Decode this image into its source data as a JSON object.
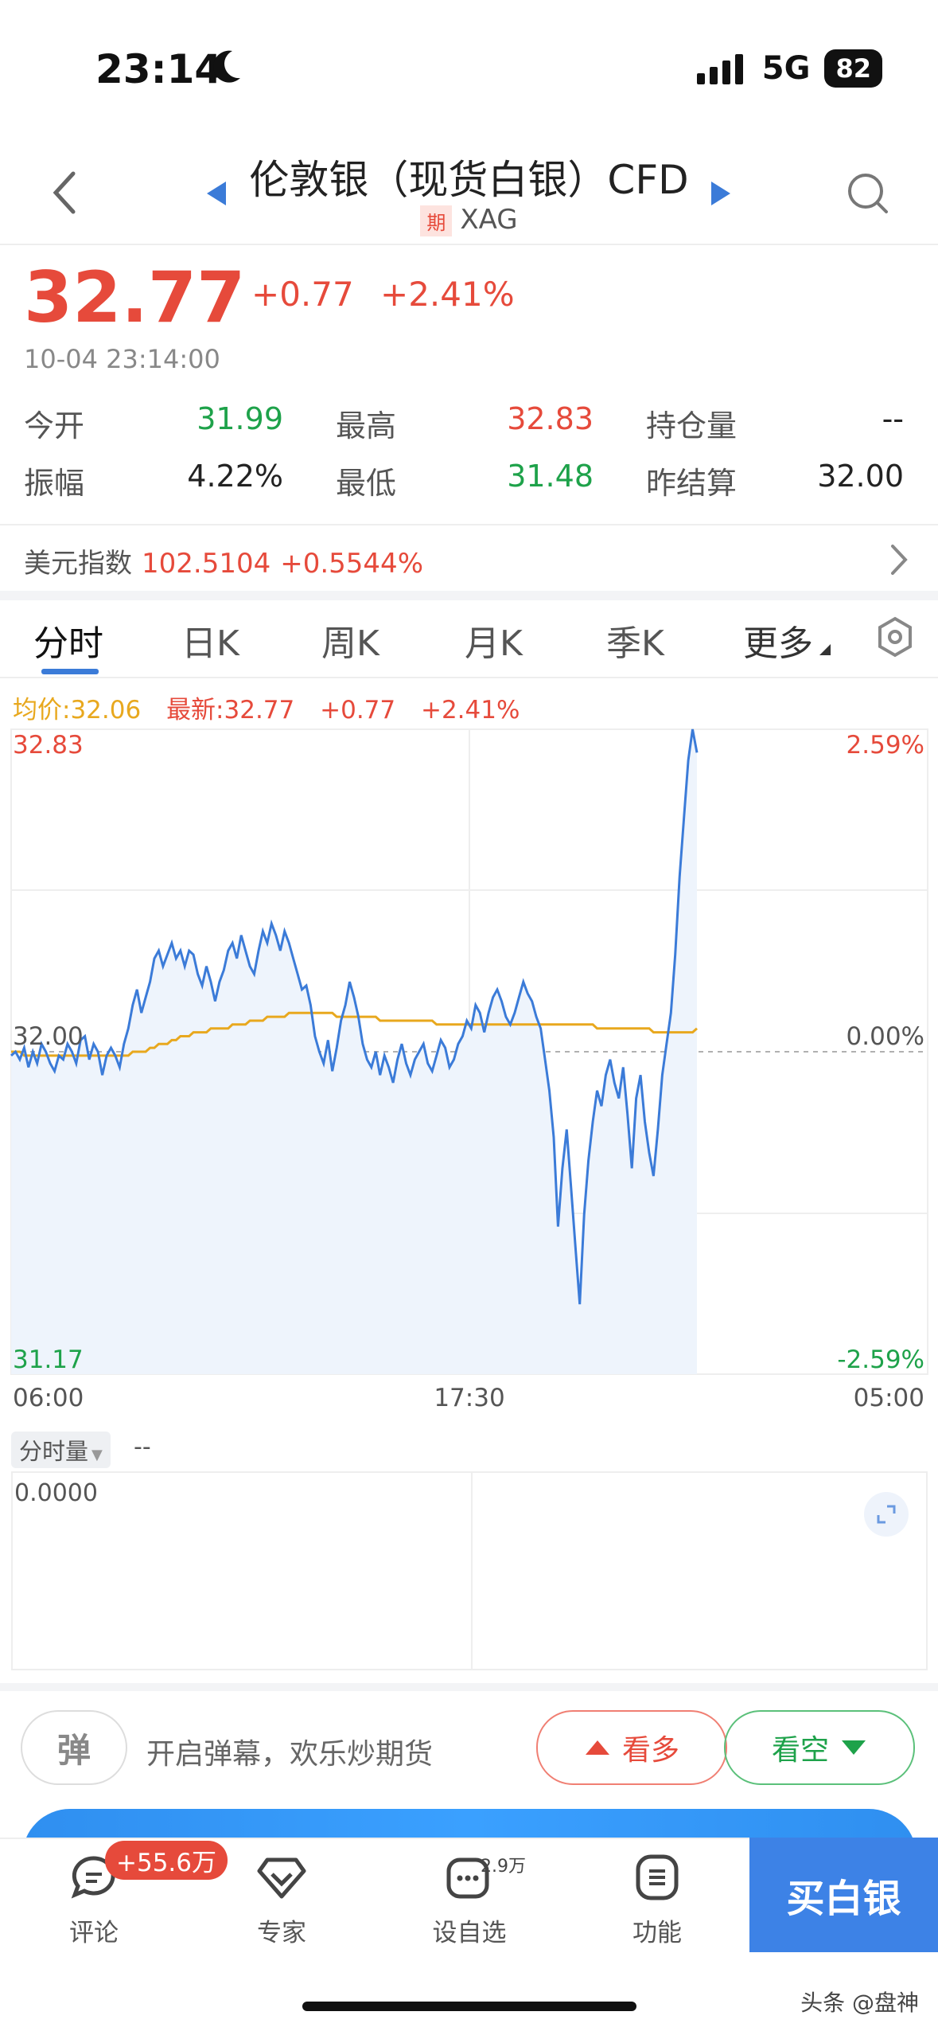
{
  "status_bar": {
    "time": "23:14",
    "network": "5G",
    "battery": "82"
  },
  "header": {
    "title": "伦敦银（现货白银）CFD",
    "tag": "期",
    "symbol": "XAG"
  },
  "quote": {
    "price": "32.77",
    "change": "+0.77",
    "change_pct": "+2.41%",
    "timestamp": "10-04 23:14:00",
    "open_label": "今开",
    "open": "31.99",
    "high_label": "最高",
    "high": "32.83",
    "oi_label": "持仓量",
    "oi": "--",
    "amp_label": "振幅",
    "amp": "4.22%",
    "low_label": "最低",
    "low": "31.48",
    "prev_label": "昨结算",
    "prev": "32.00"
  },
  "index": {
    "label": "美元指数",
    "value": "102.5104",
    "change": "+0.5544%"
  },
  "tabs": [
    "分时",
    "日K",
    "周K",
    "月K",
    "季K",
    "更多"
  ],
  "avg_row": {
    "avg": "均价:32.06",
    "latest": "最新:32.77",
    "chg": "+0.77",
    "pct": "+2.41%"
  },
  "chart_data": {
    "type": "line",
    "y_left": {
      "top": "32.83",
      "mid": "32.00",
      "bottom": "31.17"
    },
    "y_right": {
      "top": "2.59%",
      "mid": "0.00%",
      "bottom": "-2.59%"
    },
    "x_labels": [
      "06:00",
      "17:30",
      "05:00"
    ],
    "ylim": [
      31.17,
      32.83
    ],
    "series": [
      {
        "values": [
          31.99,
          32.0,
          31.98,
          32.01,
          31.96,
          32.0,
          31.97,
          32.02,
          32.0,
          31.97,
          31.95,
          31.99,
          31.98,
          32.02,
          32.0,
          31.97,
          32.03,
          32.04,
          31.98,
          32.02,
          32.0,
          31.94,
          31.99,
          32.01,
          31.99,
          31.96,
          32.02,
          32.06,
          32.12,
          32.16,
          32.1,
          32.14,
          32.18,
          32.24,
          32.26,
          32.22,
          32.25,
          32.28,
          32.24,
          32.26,
          32.22,
          32.26,
          32.25,
          32.2,
          32.17,
          32.22,
          32.18,
          32.13,
          32.18,
          32.21,
          32.26,
          32.28,
          32.24,
          32.3,
          32.26,
          32.22,
          32.2,
          32.26,
          32.31,
          32.28,
          32.33,
          32.3,
          32.26,
          32.31,
          32.28,
          32.24,
          32.2,
          32.16,
          32.17,
          32.12,
          32.04,
          32.0,
          31.97,
          32.03,
          31.95,
          32.01,
          32.08,
          32.12,
          32.18,
          32.14,
          32.09,
          32.02,
          31.98,
          31.96,
          32.0,
          31.94,
          31.99,
          31.96,
          31.92,
          31.98,
          32.02,
          31.97,
          31.94,
          31.98,
          32.0,
          32.02,
          31.97,
          31.95,
          31.99,
          32.03,
          32.01,
          31.96,
          31.98,
          32.02,
          32.04,
          32.08,
          32.06,
          32.12,
          32.1,
          32.05,
          32.1,
          32.14,
          32.16,
          32.13,
          32.09,
          32.07,
          32.1,
          32.14,
          32.18,
          32.15,
          32.13,
          32.09,
          32.06,
          31.98,
          31.9,
          31.78,
          31.55,
          31.7,
          31.8,
          31.65,
          31.5,
          31.35,
          31.58,
          31.72,
          31.82,
          31.9,
          31.86,
          31.94,
          31.98,
          31.92,
          31.88,
          31.96,
          31.84,
          31.7,
          31.88,
          31.94,
          31.82,
          31.74,
          31.68,
          31.8,
          31.94,
          32.02,
          32.1,
          32.25,
          32.45,
          32.6,
          32.75,
          32.83,
          32.77
        ]
      },
      {
        "values": [
          32.0,
          32.0,
          32.0,
          31.99,
          31.99,
          31.99,
          31.99,
          31.99,
          31.99,
          31.99,
          31.99,
          31.99,
          31.99,
          31.99,
          31.99,
          31.99,
          31.99,
          31.99,
          31.99,
          31.99,
          31.99,
          31.99,
          31.99,
          31.99,
          31.99,
          31.99,
          31.99,
          31.99,
          32.0,
          32.0,
          32.0,
          32.0,
          32.01,
          32.01,
          32.02,
          32.02,
          32.02,
          32.03,
          32.03,
          32.04,
          32.04,
          32.04,
          32.05,
          32.05,
          32.05,
          32.05,
          32.06,
          32.06,
          32.06,
          32.06,
          32.06,
          32.07,
          32.07,
          32.07,
          32.07,
          32.08,
          32.08,
          32.08,
          32.08,
          32.09,
          32.09,
          32.09,
          32.09,
          32.09,
          32.1,
          32.1,
          32.1,
          32.1,
          32.1,
          32.1,
          32.1,
          32.1,
          32.1,
          32.1,
          32.1,
          32.09,
          32.09,
          32.09,
          32.09,
          32.09,
          32.09,
          32.09,
          32.09,
          32.09,
          32.09,
          32.08,
          32.08,
          32.08,
          32.08,
          32.08,
          32.08,
          32.08,
          32.08,
          32.08,
          32.08,
          32.08,
          32.08,
          32.08,
          32.07,
          32.07,
          32.07,
          32.07,
          32.07,
          32.07,
          32.07,
          32.07,
          32.07,
          32.07,
          32.07,
          32.07,
          32.07,
          32.07,
          32.07,
          32.07,
          32.07,
          32.07,
          32.07,
          32.07,
          32.07,
          32.07,
          32.07,
          32.07,
          32.07,
          32.07,
          32.07,
          32.07,
          32.07,
          32.07,
          32.07,
          32.07,
          32.07,
          32.07,
          32.07,
          32.07,
          32.07,
          32.06,
          32.06,
          32.06,
          32.06,
          32.06,
          32.06,
          32.06,
          32.06,
          32.06,
          32.06,
          32.06,
          32.06,
          32.06,
          32.05,
          32.05,
          32.05,
          32.05,
          32.05,
          32.05,
          32.05,
          32.05,
          32.05,
          32.05,
          32.06
        ]
      }
    ]
  },
  "volume": {
    "label": "分时量",
    "value": "--",
    "axis": "0.0000"
  },
  "danmu": {
    "icon_text": "弹",
    "text": "开启弹幕，欢乐炒期货"
  },
  "trade": {
    "bull": "看多",
    "bear": "看空"
  },
  "nav": {
    "comment": "评论",
    "comment_badge": "+55.6万",
    "expert": "专家",
    "watch": "设自选",
    "watch_count": "2.9万",
    "func": "功能",
    "buy": "买白银"
  },
  "watermark": "头条 @盘神",
  "colors": {
    "up": "#e64a3b",
    "down": "#1ea24a",
    "line": "#3b7bd8",
    "avg": "#e8a81e"
  }
}
